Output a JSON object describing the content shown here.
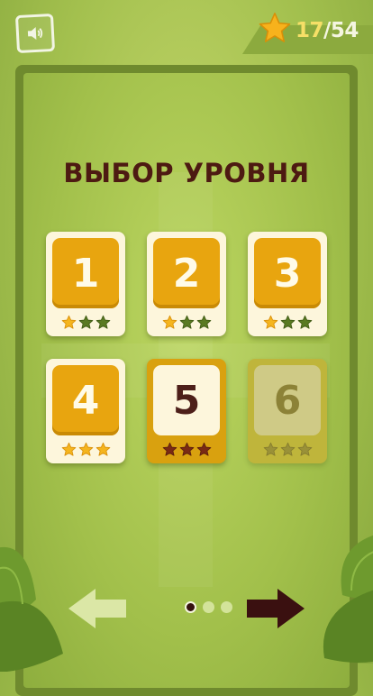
{
  "header": {
    "sound_icon": "speaker-icon",
    "stars_collected": "17",
    "stars_total": "/54",
    "star_icon": "star-icon"
  },
  "screen": {
    "title": "ВЫБОР УРОВНЯ"
  },
  "levels": [
    {
      "number": "1",
      "state": "completed",
      "stars_earned": 1,
      "stars_max": 3
    },
    {
      "number": "2",
      "state": "completed",
      "stars_earned": 1,
      "stars_max": 3
    },
    {
      "number": "3",
      "state": "completed",
      "stars_earned": 1,
      "stars_max": 3
    },
    {
      "number": "4",
      "state": "completed",
      "stars_earned": 3,
      "stars_max": 3
    },
    {
      "number": "5",
      "state": "current",
      "stars_earned": 0,
      "stars_max": 3
    },
    {
      "number": "6",
      "state": "locked",
      "stars_earned": 0,
      "stars_max": 3
    }
  ],
  "pagination": {
    "pages": 3,
    "current_page": 1,
    "prev_icon": "arrow-left-icon",
    "next_icon": "arrow-right-icon"
  },
  "colors": {
    "accent_gold": "#e8a50f",
    "title_text": "#4d1a12",
    "background_green": "#a3c04e",
    "star_earned": "#f5b51e",
    "star_empty": "#5a7a22"
  }
}
